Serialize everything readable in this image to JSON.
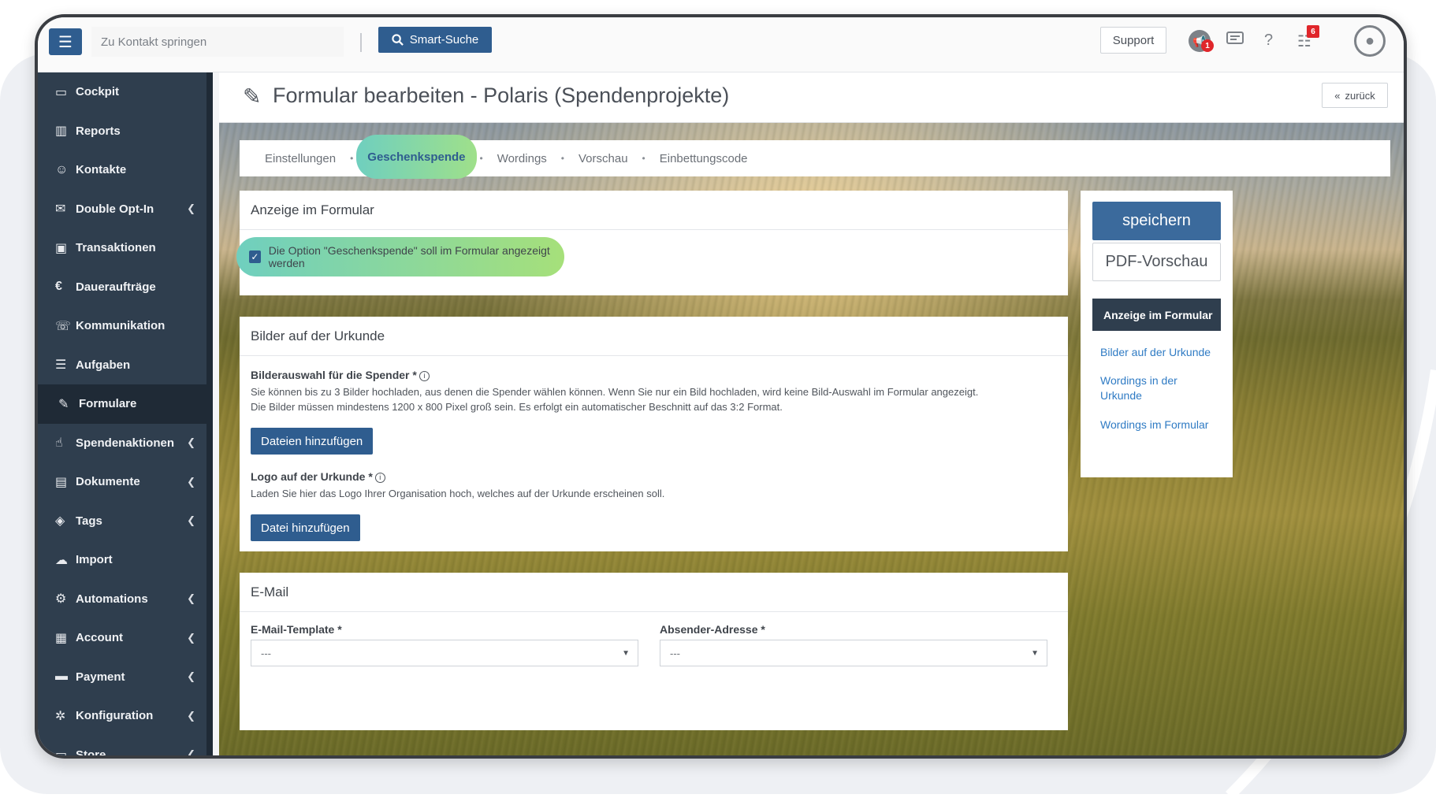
{
  "topbar": {
    "search_placeholder": "Zu Kontakt springen",
    "smart_search_label": "Smart-Suche",
    "support_label": "Support",
    "notify_badge": "1",
    "tasks_badge": "6"
  },
  "sidebar": {
    "items": [
      {
        "label": "Cockpit",
        "icon": "laptop-icon"
      },
      {
        "label": "Reports",
        "icon": "chart-icon"
      },
      {
        "label": "Kontakte",
        "icon": "users-icon"
      },
      {
        "label": "Double Opt-In",
        "icon": "envelope-icon"
      },
      {
        "label": "Transaktionen",
        "icon": "money-icon"
      },
      {
        "label": "Daueraufträge",
        "icon": "refresh-euro-icon"
      },
      {
        "label": "Kommunikation",
        "icon": "chat-icon"
      },
      {
        "label": "Aufgaben",
        "icon": "list-icon"
      },
      {
        "label": "Formulare",
        "icon": "edit-icon"
      },
      {
        "label": "Spendenaktionen",
        "icon": "thumbs-up-icon"
      },
      {
        "label": "Dokumente",
        "icon": "file-icon"
      },
      {
        "label": "Tags",
        "icon": "tags-icon"
      },
      {
        "label": "Import",
        "icon": "cloud-upload-icon"
      },
      {
        "label": "Automations",
        "icon": "robot-icon"
      },
      {
        "label": "Account",
        "icon": "briefcase-icon"
      },
      {
        "label": "Payment",
        "icon": "credit-card-icon"
      },
      {
        "label": "Konfiguration",
        "icon": "gear-icon"
      },
      {
        "label": "Store",
        "icon": "store-icon"
      }
    ]
  },
  "page": {
    "title": "Formular bearbeiten - Polaris (Spendenprojekte)",
    "back_label": "zurück"
  },
  "tabs": [
    {
      "label": "Einstellungen"
    },
    {
      "label": "Geschenkspende"
    },
    {
      "label": "Wordings"
    },
    {
      "label": "Vorschau"
    },
    {
      "label": "Einbettungscode"
    }
  ],
  "anzeige": {
    "title": "Anzeige im Formular",
    "checkbox_label": "Die Option \"Geschenkspende\" soll im Formular angezeigt werden"
  },
  "bilder": {
    "title": "Bilder auf der Urkunde",
    "field1_label": "Bilderauswahl für die Spender *",
    "field1_help_1": "Sie können bis zu 3 Bilder hochladen, aus denen die Spender wählen können. Wenn Sie nur ein Bild hochladen, wird keine Bild-Auswahl im Formular angezeigt.",
    "field1_help_2": "Die Bilder müssen mindestens 1200 x 800 Pixel groß sein. Es erfolgt ein automatischer Beschnitt auf das 3:2 Format.",
    "field1_button": "Dateien hinzufügen",
    "field2_label": "Logo auf der Urkunde *",
    "field2_help": "Laden Sie hier das Logo Ihrer Organisation hoch, welches auf der Urkunde erscheinen soll.",
    "field2_button": "Datei hinzufügen"
  },
  "email": {
    "title": "E-Mail",
    "template_label": "E-Mail-Template *",
    "template_value": "---",
    "sender_label": "Absender-Adresse *",
    "sender_value": "---"
  },
  "side_panel": {
    "save_label": "speichern",
    "pdf_label": "PDF-Vorschau",
    "nav_active": "Anzeige im Formular",
    "nav_links": [
      "Bilder auf der Urkunde",
      "Wordings in der Urkunde",
      "Wordings im Formular"
    ]
  }
}
